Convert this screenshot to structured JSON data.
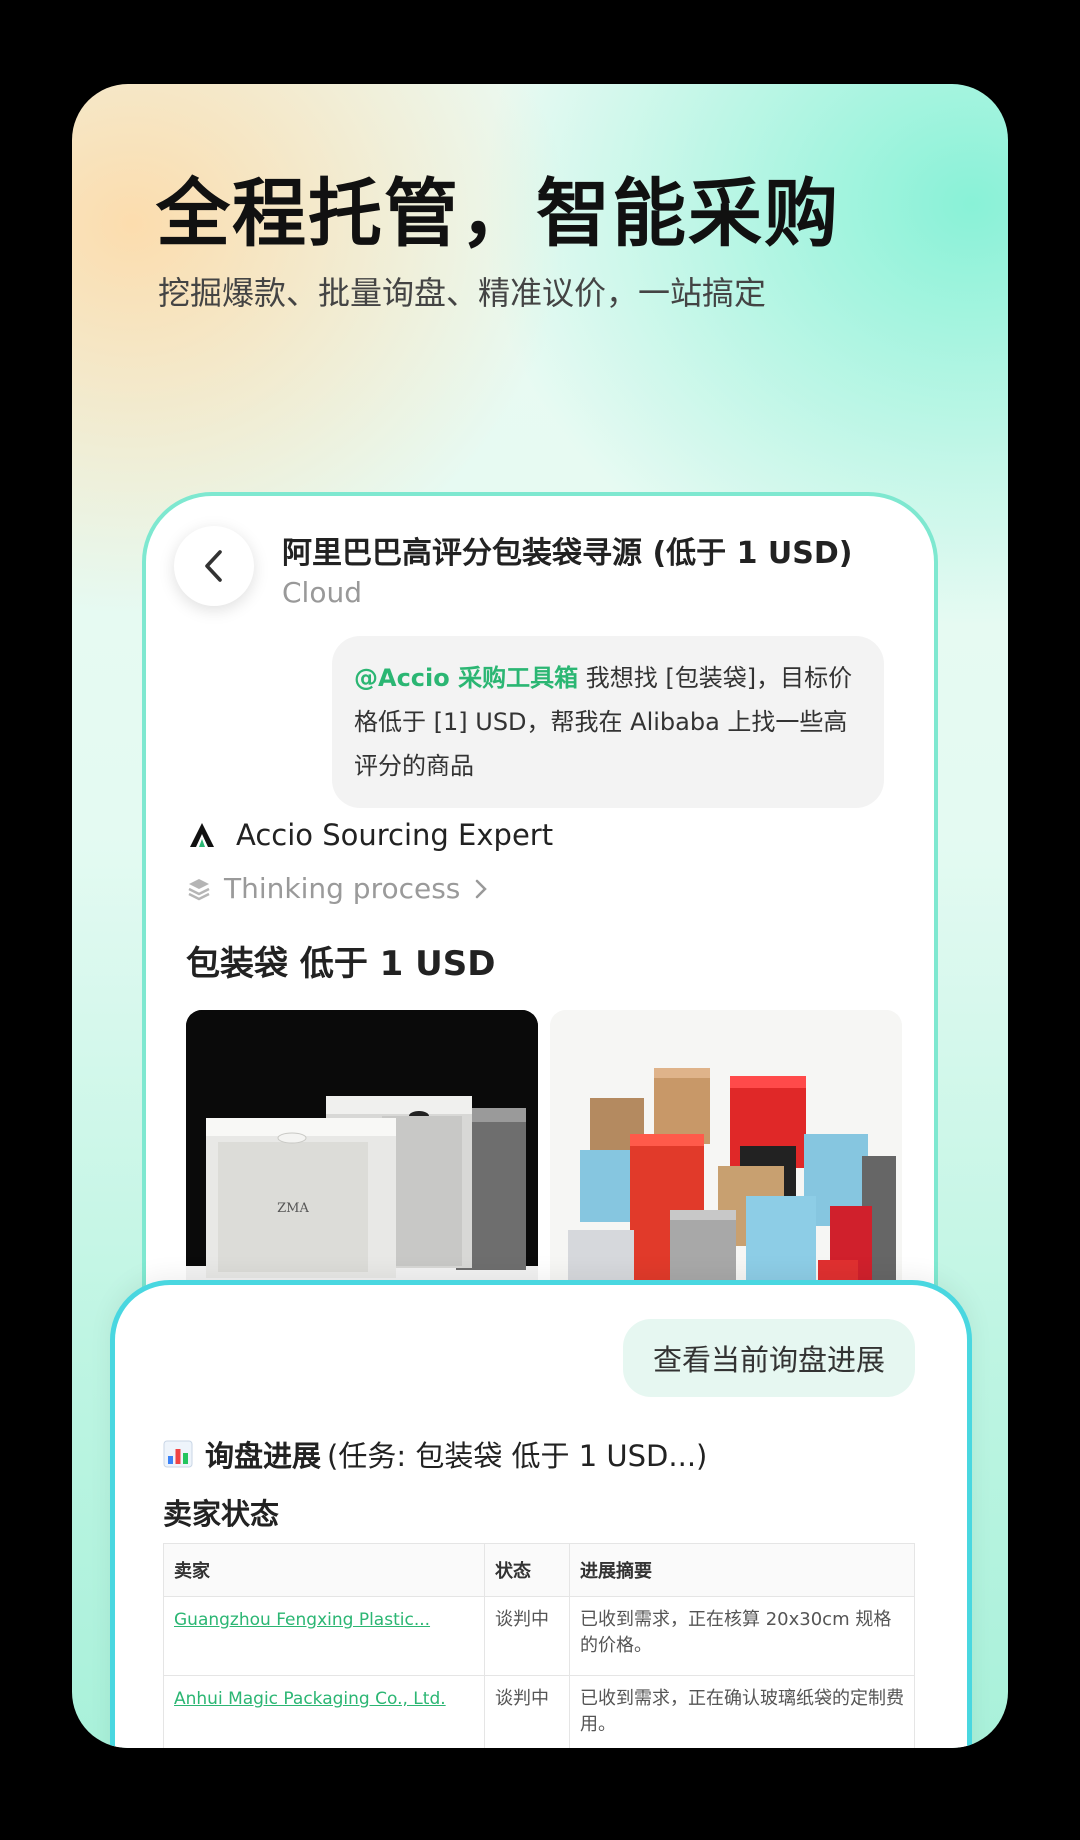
{
  "hero": {
    "title": "全程托管，智能采购",
    "subtitle": "挖掘爆款、批量询盘、精准议价，一站搞定"
  },
  "chat": {
    "title": "阿里巴巴高评分包装袋寻源 (低于 1 USD)",
    "subtitle": "Cloud",
    "user_message": {
      "mention": "@Accio 采购工具箱",
      "text": " 我想找 [包装袋]，目标价格低于 [1] USD，帮我在 Alibaba 上找一些高评分的商品"
    },
    "agent_name": "Accio Sourcing Expert",
    "thinking_label": "Thinking process",
    "result_title": "包装袋 低于 1 USD",
    "products": [
      {
        "icon": "frosted-zip-bags-image",
        "print": "ZMA"
      },
      {
        "icon": "colorful-coffee-pouches-image"
      }
    ]
  },
  "inquiry": {
    "button_label": "查看当前询盘进展",
    "progress_title": "询盘进展",
    "progress_task": "(任务: 包装袋 低于 1 USD...)",
    "seller_status_title": "卖家状态",
    "table": {
      "columns": [
        "卖家",
        "状态",
        "进展摘要"
      ],
      "rows": [
        {
          "seller": "Guangzhou Fengxing Plastic...",
          "status": "谈判中",
          "summary": "已收到需求，正在核算 20x30cm 规格的价格。"
        },
        {
          "seller": "Anhui Magic Packaging Co., Ltd.",
          "status": "谈判中",
          "summary": "已收到需求，正在确认玻璃纸袋的定制费用。"
        }
      ]
    }
  },
  "colors": {
    "accent_green": "#2bb673",
    "card_border": "#7ee8d0",
    "panel_border": "#49d7e0"
  }
}
